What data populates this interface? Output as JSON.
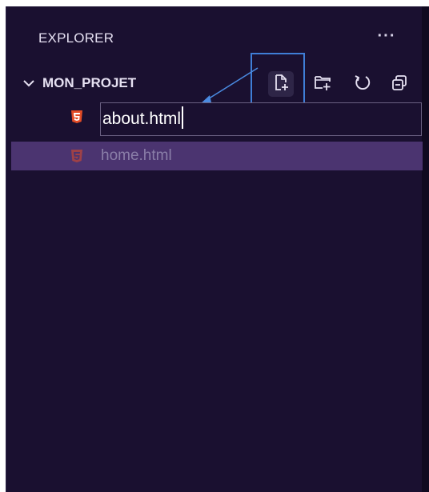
{
  "explorer": {
    "title": "EXPLORER",
    "more_label": "···"
  },
  "project": {
    "name": "MON_PROJET",
    "toolbar": [
      {
        "icon": "new-file-icon",
        "label": "New File"
      },
      {
        "icon": "new-folder-icon",
        "label": "New Folder"
      },
      {
        "icon": "refresh-icon",
        "label": "Refresh"
      },
      {
        "icon": "collapse-all-icon",
        "label": "Collapse All"
      }
    ]
  },
  "tree": {
    "new_file_input": {
      "value": "about.html",
      "icon": "html5-icon"
    },
    "files": [
      {
        "name": "home.html",
        "icon": "html5-icon",
        "selected": true
      }
    ]
  },
  "colors": {
    "background": "#1a1030",
    "selection": "#4b3470",
    "html_icon": "#e34c26",
    "annotation": "#3f7ed6"
  }
}
